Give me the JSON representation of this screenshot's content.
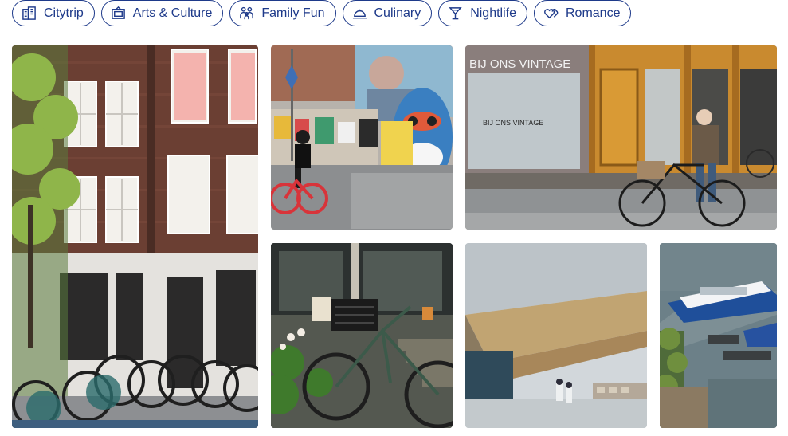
{
  "filters": [
    {
      "label": "Citytrip",
      "icon": "building-icon"
    },
    {
      "label": "Arts & Culture",
      "icon": "frame-icon"
    },
    {
      "label": "Family Fun",
      "icon": "family-icon"
    },
    {
      "label": "Culinary",
      "icon": "cloche-icon"
    },
    {
      "label": "Nightlife",
      "icon": "cocktail-icon"
    },
    {
      "label": "Romance",
      "icon": "hearts-icon"
    }
  ],
  "gallery": {
    "shop_sign": "BIJ ONS VINTAGE",
    "window_text": "BIJ ONS VINTAGE",
    "colors": {
      "chip_border": "#1e3a8a",
      "chip_text": "#1e3a8a"
    }
  }
}
